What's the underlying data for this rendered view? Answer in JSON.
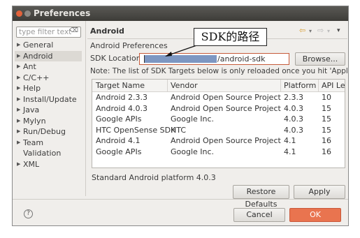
{
  "window": {
    "title": "Preferences"
  },
  "filter": {
    "placeholder": "type filter text"
  },
  "nav": {
    "items": [
      {
        "label": "General",
        "expandable": true
      },
      {
        "label": "Android",
        "expandable": true,
        "selected": true
      },
      {
        "label": "Ant",
        "expandable": true
      },
      {
        "label": "C/C++",
        "expandable": true
      },
      {
        "label": "Help",
        "expandable": true
      },
      {
        "label": "Install/Update",
        "expandable": true
      },
      {
        "label": "Java",
        "expandable": true
      },
      {
        "label": "Mylyn",
        "expandable": true
      },
      {
        "label": "Run/Debug",
        "expandable": true
      },
      {
        "label": "Team",
        "expandable": true
      },
      {
        "label": "Validation",
        "expandable": false
      },
      {
        "label": "XML",
        "expandable": true
      }
    ]
  },
  "page": {
    "title": "Android",
    "subtitle": "Android Preferences",
    "sdk_label": "SDK Location:",
    "sdk_value": "/android-sdk",
    "browse": "Browse...",
    "note": "Note: The list of SDK Targets below is only reloaded once you hit 'Apply' or 'OK'.",
    "platform_desc": "Standard Android platform 4.0.3"
  },
  "table": {
    "headers": [
      "Target Name",
      "Vendor",
      "Platform",
      "API Le"
    ],
    "rows": [
      [
        "Android 2.3.3",
        "Android Open Source Project",
        "2.3.3",
        "10"
      ],
      [
        "Android 4.0.3",
        "Android Open Source Project",
        "4.0.3",
        "15"
      ],
      [
        "Google APIs",
        "Google Inc.",
        "4.0.3",
        "15"
      ],
      [
        "HTC OpenSense SDK",
        "HTC",
        "4.0.3",
        "15"
      ],
      [
        "Android 4.1",
        "Android Open Source Project",
        "4.1",
        "16"
      ],
      [
        "Google APIs",
        "Google Inc.",
        "4.1",
        "16"
      ]
    ]
  },
  "buttons": {
    "restore": "Restore Defaults",
    "apply": "Apply",
    "cancel": "Cancel",
    "ok": "OK"
  },
  "callout": {
    "text": "SDK的路径"
  },
  "icons": {
    "help": "?",
    "back": "⇦",
    "forward": "⇨",
    "menu": "▾",
    "clear": "⌫"
  },
  "colors": {
    "accent": "#e9744f",
    "redact": "#7d97c2",
    "input_border": "#c65a3a"
  }
}
